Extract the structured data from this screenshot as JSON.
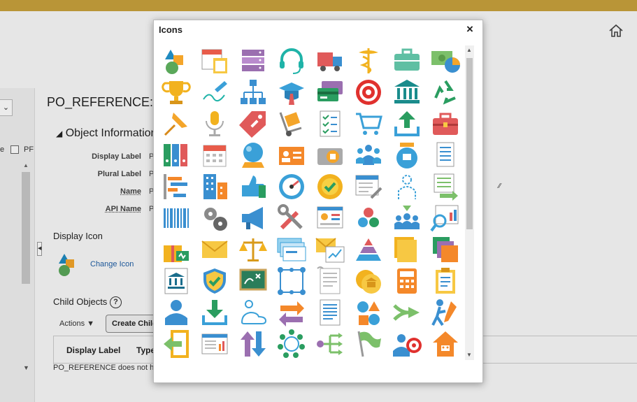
{
  "page": {
    "title": "PO_REFERENCE:",
    "section_title": "Object Information",
    "form": [
      {
        "label": "Display Label",
        "value": "P"
      },
      {
        "label": "Plural Label",
        "value": "P"
      },
      {
        "label": "Name",
        "value": "P"
      },
      {
        "label": "API Name",
        "value": "P"
      }
    ],
    "display_icon_label": "Display Icon",
    "change_icon": "Change Icon",
    "child_objects": "Child Objects",
    "help": "?",
    "actions": "Actions ▼",
    "create_child": "Create Child",
    "columns": [
      "Display Label",
      "Type"
    ],
    "empty_text": "PO_REFERENCE does not h",
    "left_text": "e",
    "left_pf": "PF",
    "left_dropdown": "⌄"
  },
  "modal": {
    "title": "Icons",
    "close": "×"
  },
  "icons": [
    "shapes-icon",
    "calendar-clipboard-icon",
    "server-icon",
    "headset-icon",
    "truck-icon",
    "caduceus-icon",
    "briefcase-icon",
    "money-chart-icon",
    "trophy-icon",
    "signature-icon",
    "org-chart-icon",
    "graduation-cap-icon",
    "credit-cards-icon",
    "target-icon",
    "bank-icon",
    "recycle-icon",
    "pushpin-icon",
    "microphone-icon",
    "price-tag-icon",
    "hand-truck-icon",
    "checklist-icon",
    "shopping-cart-icon",
    "upload-icon",
    "toolbox-icon",
    "binders-icon",
    "calendar-icon",
    "crystal-ball-icon",
    "contact-card-icon",
    "camera-bank-icon",
    "team-icon",
    "jar-icon",
    "document-icon",
    "gantt-icon",
    "buildings-icon",
    "thumbs-up-icon",
    "gauge-icon",
    "badge-check-icon",
    "browser-tools-icon",
    "outline-person-icon",
    "list-arrow-icon",
    "barcode-icon",
    "gears-icon",
    "megaphone-icon",
    "tools-icon",
    "dashboard-panel-icon",
    "circles-icon",
    "group-download-icon",
    "magnify-chart-icon",
    "gift-icon",
    "envelope-icon",
    "scales-icon",
    "checks-icon",
    "email-chart-icon",
    "pyramid-icon",
    "folders-icon",
    "layers-icon",
    "bank-doc-icon",
    "shield-check-icon",
    "chalkboard-icon",
    "network-icon",
    "contract-icon",
    "coin-bank-icon",
    "calculator-icon",
    "clipboard-icon",
    "person-icon",
    "download-icon",
    "people-cloud-icon",
    "swap-arrows-icon",
    "text-doc-icon",
    "shapes-mix-icon",
    "merge-arrow-icon",
    "pencil-person-icon",
    "exit-icon",
    "report-icon",
    "up-down-arrows-icon",
    "cycle-icon",
    "split-flow-icon",
    "flag-icon",
    "person-target-icon",
    "house-icon"
  ]
}
